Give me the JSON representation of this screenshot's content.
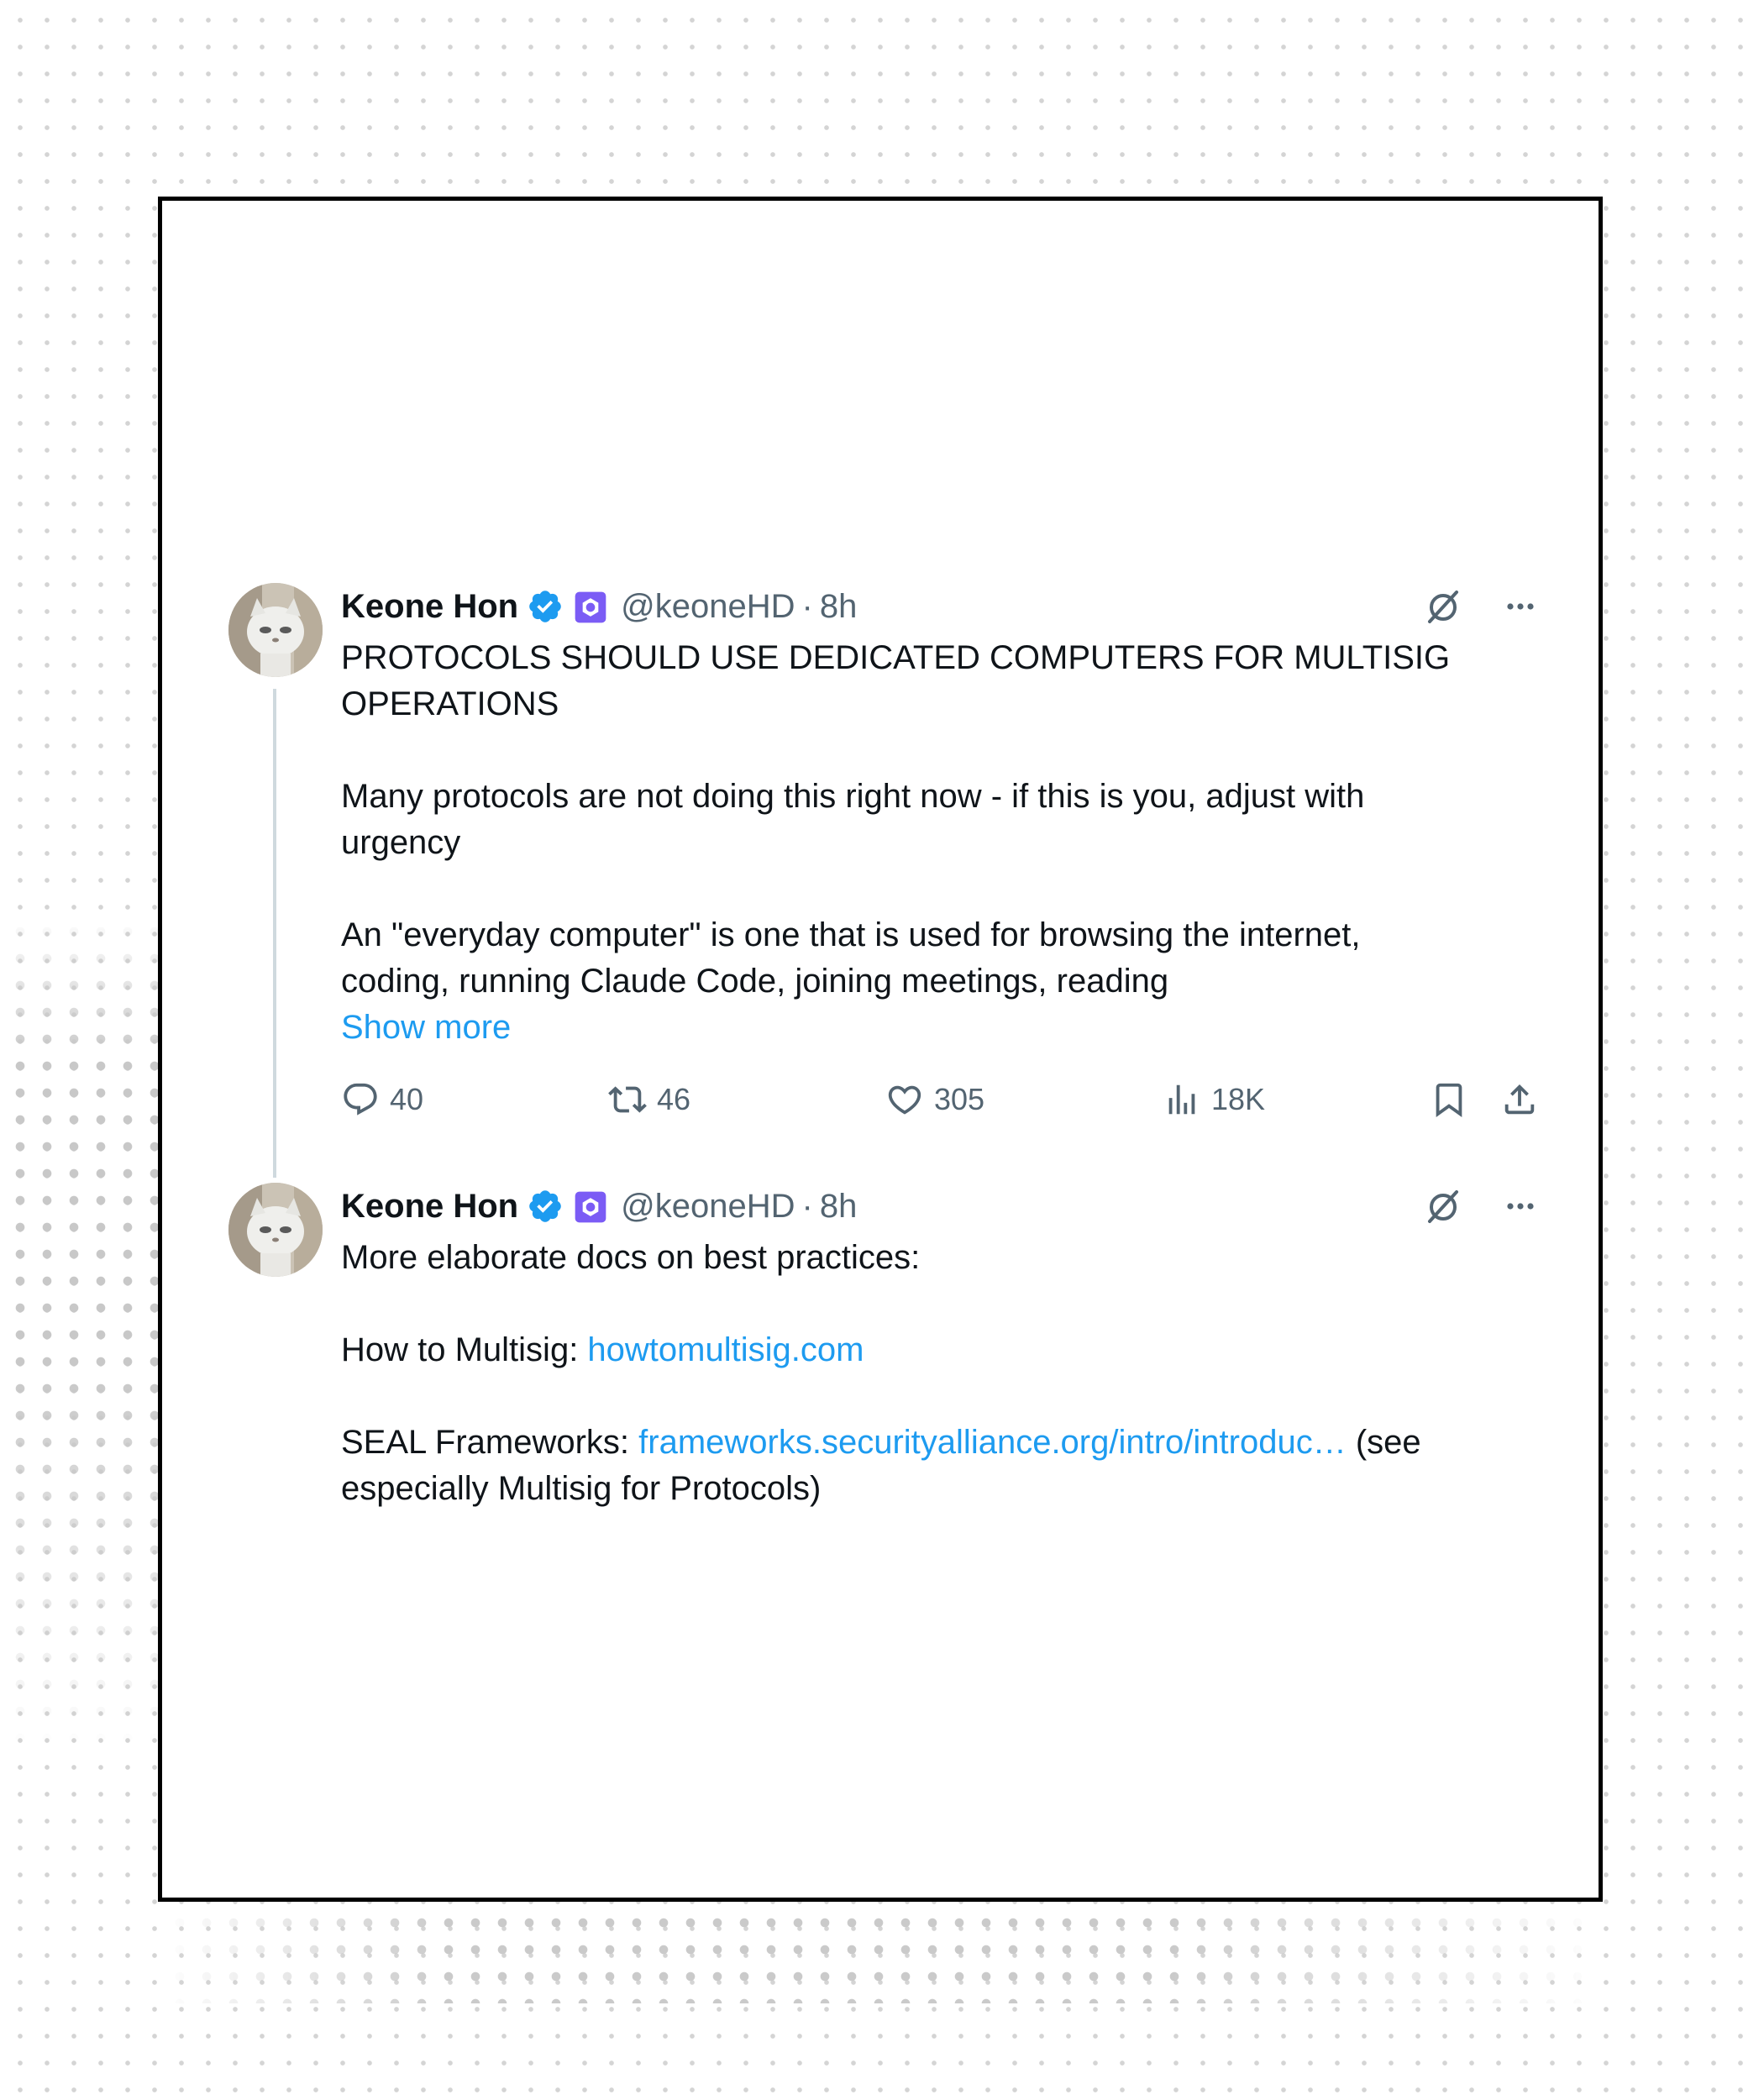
{
  "colors": {
    "text": "#0f1419",
    "secondary": "#536471",
    "link": "#1d9bf0",
    "verified": "#1d9bf0",
    "affiliate": "#7b5cf5",
    "thread_line": "#cfd9de",
    "frame_border": "#000000"
  },
  "tweets": [
    {
      "author_name": "Keone Hon",
      "handle": "@keoneHD",
      "separator": "·",
      "time": "8h",
      "icons": [
        "avatar",
        "verified-badge-icon",
        "affiliate-badge-icon",
        "grok-icon",
        "more-icon"
      ],
      "lines": [
        "PROTOCOLS SHOULD USE DEDICATED COMPUTERS FOR MULTISIG",
        "OPERATIONS",
        "",
        "Many protocols are not doing this right now - if this is you, adjust with",
        "urgency",
        "",
        "An \"everyday computer\" is one that is used for browsing the internet,",
        "coding, running Claude Code, joining meetings, reading"
      ],
      "show_more": "Show more",
      "stats": {
        "replies": "40",
        "retweets": "46",
        "likes": "305",
        "views": "18K"
      }
    },
    {
      "author_name": "Keone Hon",
      "handle": "@keoneHD",
      "separator": "·",
      "time": "8h",
      "intro": "More elaborate docs on best practices:",
      "howto_label": "How to Multisig: ",
      "howto_link": "howtomultisig.com",
      "seal_label": "SEAL Frameworks: ",
      "seal_link": "frameworks.securityalliance.org/intro/introduc…",
      "seal_suffix": " (see",
      "seal_line2": "especially Multisig for Protocols)"
    }
  ]
}
